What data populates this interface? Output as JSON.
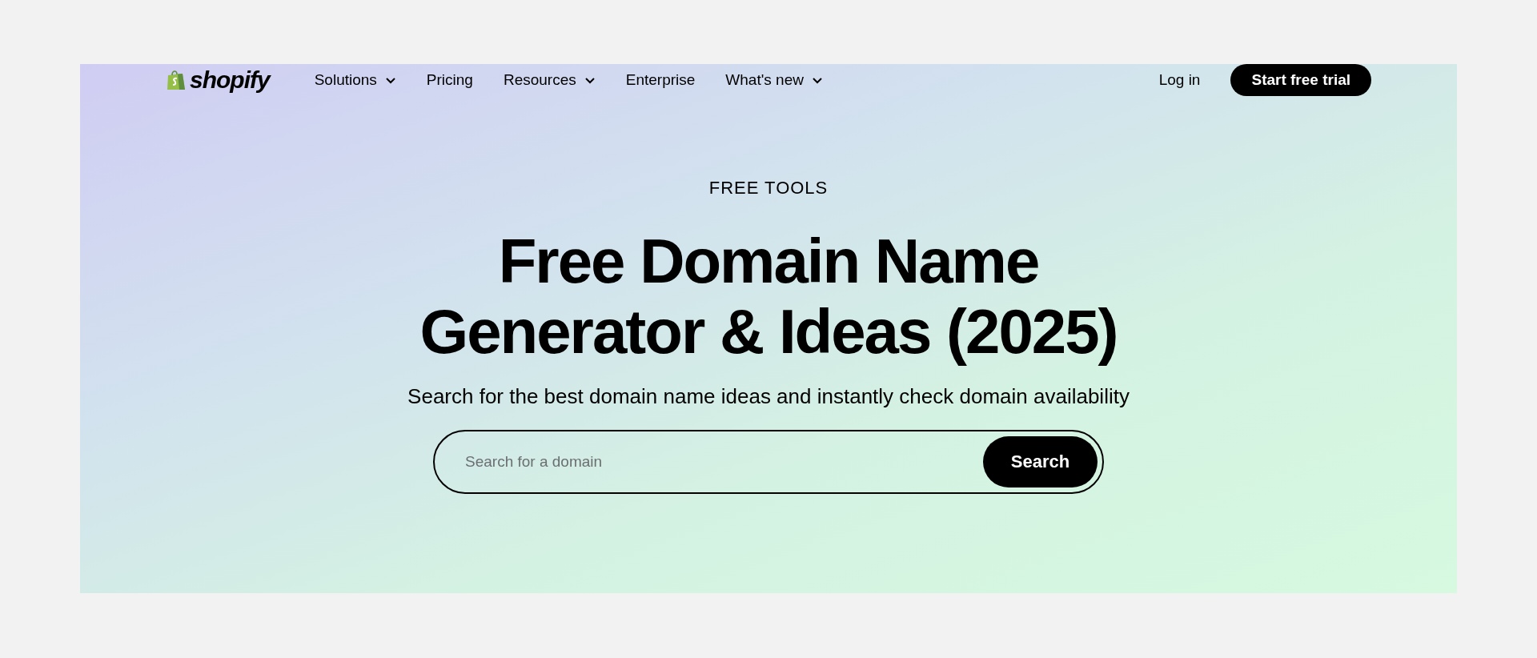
{
  "nav": {
    "logo": "shopify",
    "items": [
      {
        "label": "Solutions",
        "dropdown": true
      },
      {
        "label": "Pricing",
        "dropdown": false
      },
      {
        "label": "Resources",
        "dropdown": true
      },
      {
        "label": "Enterprise",
        "dropdown": false
      },
      {
        "label": "What's new",
        "dropdown": true
      }
    ],
    "login": "Log in",
    "cta": "Start free trial"
  },
  "hero": {
    "eyebrow": "FREE TOOLS",
    "title": [
      "Free Domain Name",
      "Generator & Ideas (2025)"
    ],
    "subtitle": "Search for the best domain name ideas and instantly check domain availability",
    "search": {
      "placeholder": "Search for a domain",
      "button": "Search"
    }
  }
}
